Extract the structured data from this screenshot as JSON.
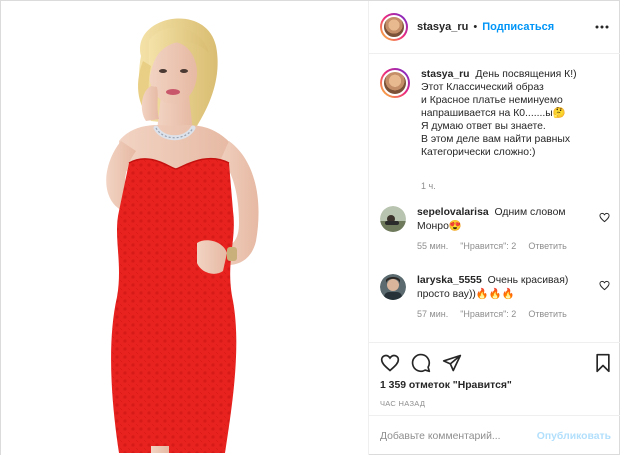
{
  "header": {
    "username": "stasya_ru",
    "separator": "•",
    "follow_label": "Подписаться",
    "more_icon": "more-horizontal-icon"
  },
  "caption": {
    "username": "stasya_ru",
    "text": "День посвящения К!)\nЭтот Классический образ\nи Красное платье неминуемо\nнапрашивается на К0.......ы🤔\nЯ думаю ответ вы знаете.\nВ этом деле вам найти равных\nКатегорически сложно:)",
    "time": "1 ч."
  },
  "comments": [
    {
      "username": "sepelovalarisa",
      "text": "Одним словом Монро😍",
      "time": "55 мин.",
      "likes": "\"Нравится\": 2",
      "reply": "Ответить"
    },
    {
      "username": "laryska_5555",
      "text": "Очень красивая) просто вау))🔥🔥🔥",
      "time": "57 мин.",
      "likes": "\"Нравится\": 2",
      "reply": "Ответить"
    }
  ],
  "actions": {
    "icons": [
      "heart-icon",
      "comment-icon",
      "share-icon",
      "bookmark-icon"
    ],
    "likes_text": "1 359 отметок \"Нравится\"",
    "posted_ago": "ЧАС НАЗАД"
  },
  "composer": {
    "placeholder": "Добавьте комментарий...",
    "publish_label": "Опубликовать"
  },
  "colors": {
    "link_blue": "#0095f6",
    "publish_disabled": "#b2dffc",
    "muted": "#8e8e8e",
    "dress_red": "#e8221e"
  }
}
